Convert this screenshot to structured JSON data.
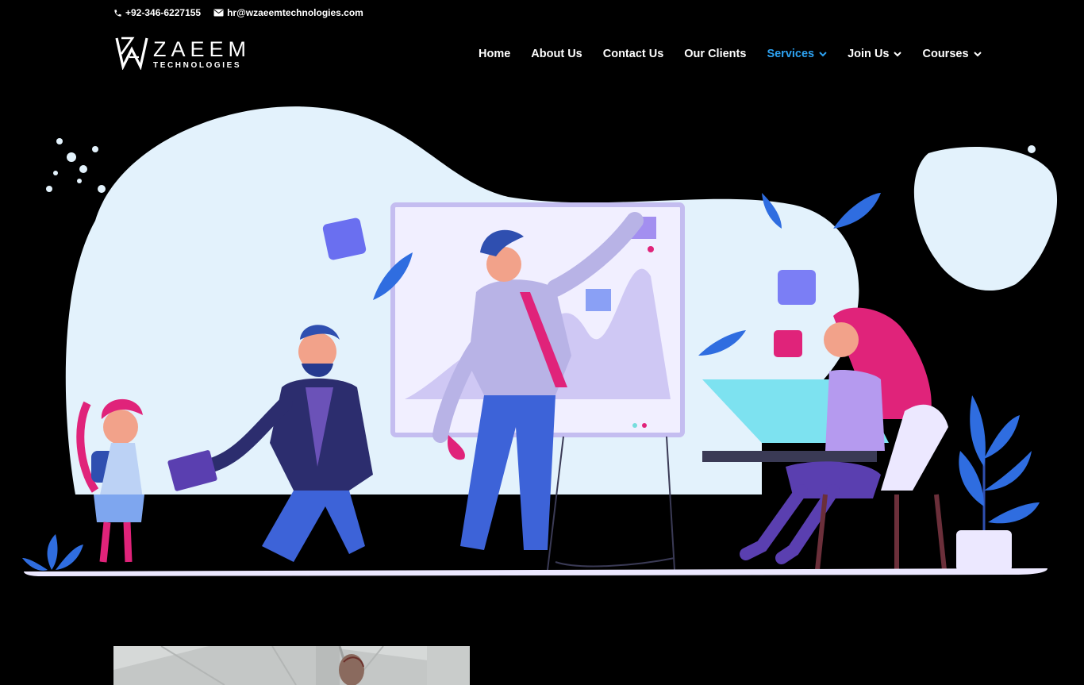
{
  "topbar": {
    "phone": "+92-346-6227155",
    "email": "hr@wzaeemtechnologies.com",
    "phone_icon": "phone-icon",
    "email_icon": "envelope-icon"
  },
  "brand": {
    "name": "ZAEEM",
    "tagline": "TECHNOLOGIES",
    "logo_icon": "wz-monogram-logo"
  },
  "nav": {
    "items": [
      {
        "label": "Home",
        "has_dropdown": false,
        "active": false
      },
      {
        "label": "About Us",
        "has_dropdown": false,
        "active": false
      },
      {
        "label": "Contact Us",
        "has_dropdown": false,
        "active": false
      },
      {
        "label": "Our Clients",
        "has_dropdown": false,
        "active": false
      },
      {
        "label": "Services",
        "has_dropdown": true,
        "active": true
      },
      {
        "label": "Join Us",
        "has_dropdown": true,
        "active": false
      },
      {
        "label": "Courses",
        "has_dropdown": true,
        "active": false
      }
    ]
  },
  "colors": {
    "background": "#000000",
    "text": "#ffffff",
    "accent": "#2ea3f2",
    "blob": "#e3f2fc",
    "magenta": "#e0237a",
    "purple": "#5a3fb0",
    "blue": "#2f6de0"
  }
}
